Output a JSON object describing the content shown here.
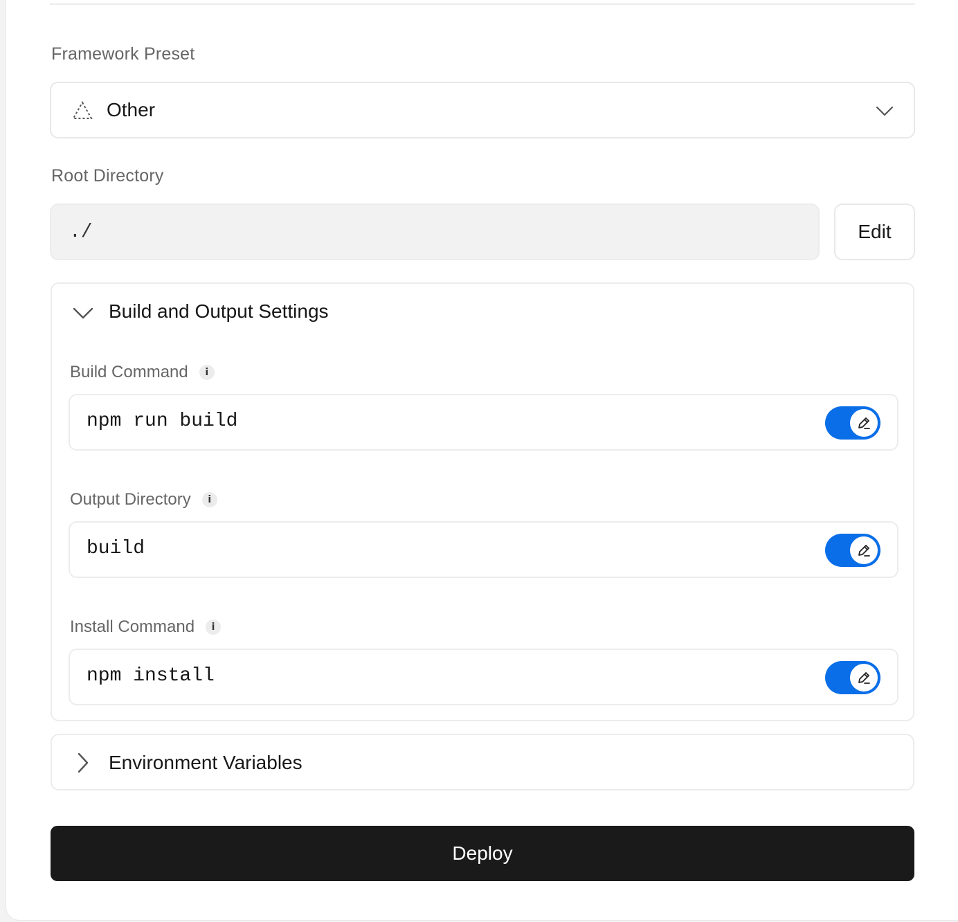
{
  "framework": {
    "label": "Framework Preset",
    "selected": "Other"
  },
  "root": {
    "label": "Root Directory",
    "value": "./",
    "edit_label": "Edit"
  },
  "build_settings": {
    "title": "Build and Output Settings",
    "fields": [
      {
        "label": "Build Command",
        "value": "npm run build",
        "override_enabled": true
      },
      {
        "label": "Output Directory",
        "value": "build",
        "override_enabled": true
      },
      {
        "label": "Install Command",
        "value": "npm install",
        "override_enabled": true
      }
    ]
  },
  "env": {
    "title": "Environment Variables"
  },
  "deploy_label": "Deploy",
  "colors": {
    "accent": "#0a6ee8",
    "deploy_bg": "#1a1a1a"
  }
}
